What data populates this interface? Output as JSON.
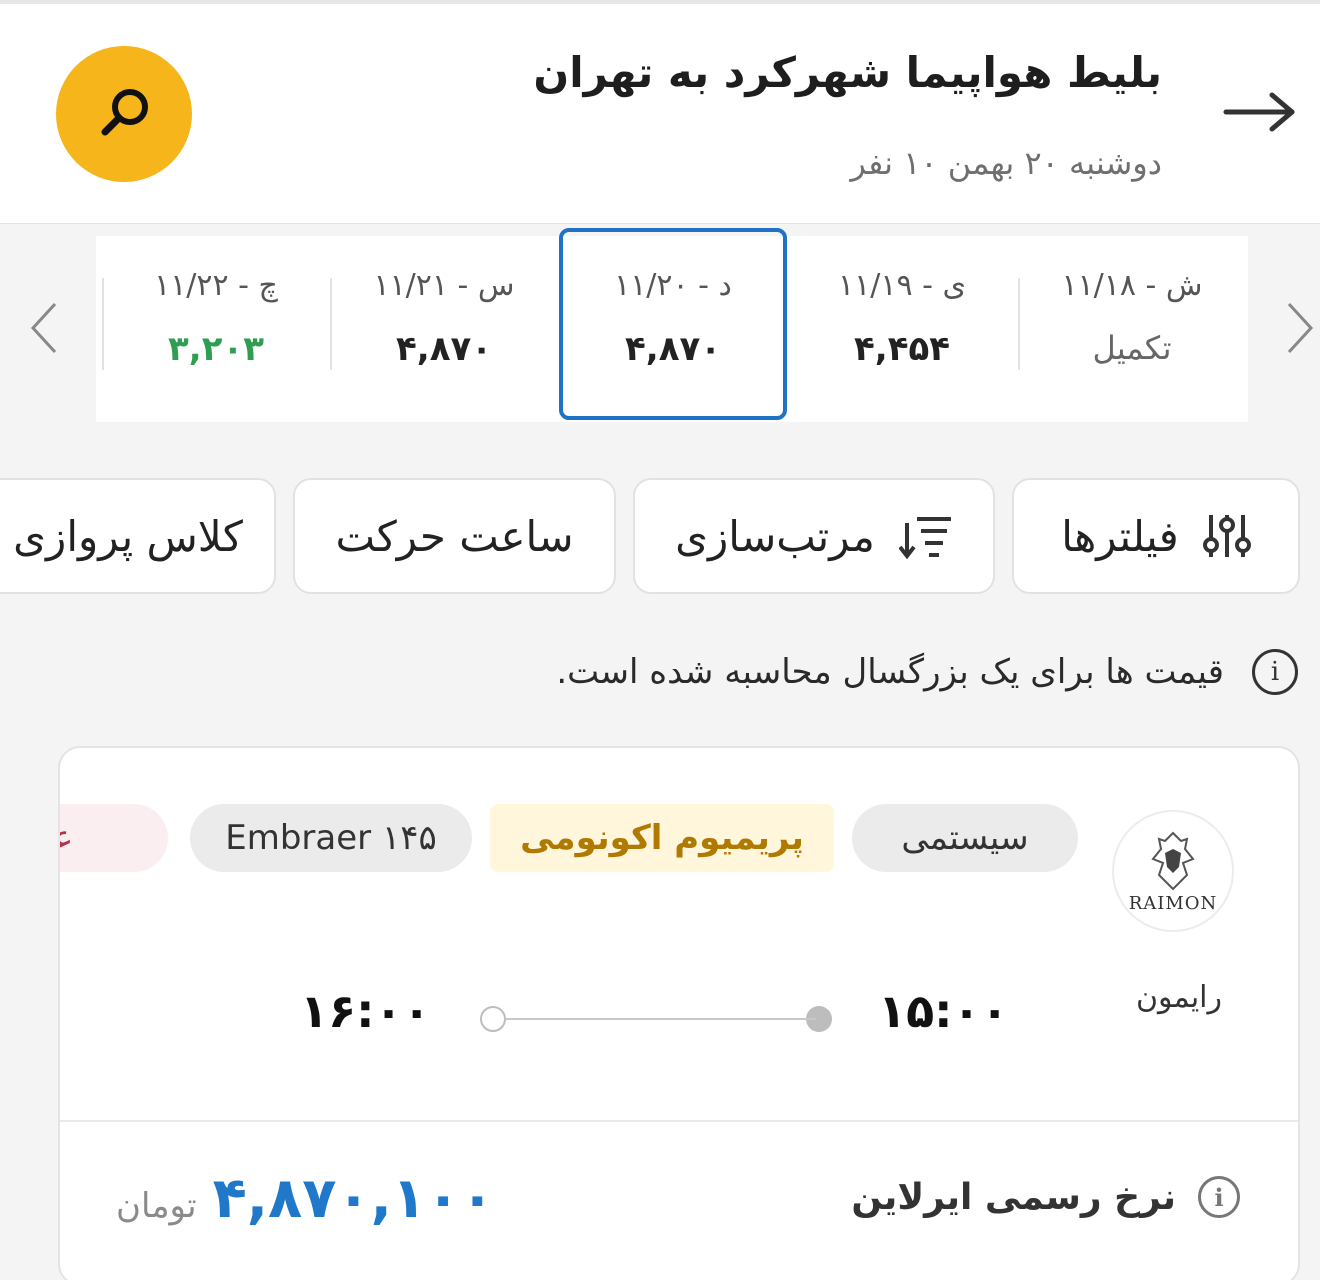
{
  "header": {
    "title": "بلیط هواپیما شهرکرد به تهران",
    "subtitle": "دوشنبه ۲۰ بهمن ۱۰ نفر"
  },
  "icons": {
    "back": "arrow-right-icon",
    "search": "search-icon",
    "prev_date": "chevron-left-icon",
    "next_date": "chevron-right-icon",
    "filters": "sliders-icon",
    "sort": "sort-icon",
    "info": "info-icon"
  },
  "dates": [
    {
      "label": "چ - ۱۱/۲۲",
      "price": "۳,۲۰۳",
      "status": "cheapest"
    },
    {
      "label": "س - ۱۱/۲۱",
      "price": "۴,۸۷۰",
      "status": "normal"
    },
    {
      "label": "د - ۱۱/۲۰",
      "price": "۴,۸۷۰",
      "status": "selected"
    },
    {
      "label": "ی - ۱۱/۱۹",
      "price": "۴,۴۵۴",
      "status": "normal"
    },
    {
      "label": "ش - ۱۱/۱۸",
      "price": "تکمیل",
      "status": "soldout"
    }
  ],
  "filters": {
    "filters_label": "فیلترها",
    "sort_label": "مرتب‌سازی",
    "departure_time_label": "ساعت حرکت",
    "flight_class_label": "کلاس پروازی"
  },
  "notice": "قیمت ها برای یک بزرگسال محاسبه شده است.",
  "flight": {
    "logo_text": "RAIMON",
    "airline": "رایمون",
    "tags": {
      "type": "سیستمی",
      "class": "پریمیوم اکونومی",
      "aircraft": "Embraer ۱۴۵",
      "extra": "عدد"
    },
    "departure_time": "۱۵:۰۰",
    "arrival_time": "۱۶:۰۰",
    "rate_label": "نرخ رسمی ایرلاین",
    "price": "۴,۸۷۰,۱۰۰",
    "currency": "تومان"
  },
  "colors": {
    "accent": "#1f72c6",
    "search_button": "#f5b51b",
    "price": "#1f78c9",
    "cheap_price": "#2f9e52",
    "premium_text": "#b07a00"
  }
}
